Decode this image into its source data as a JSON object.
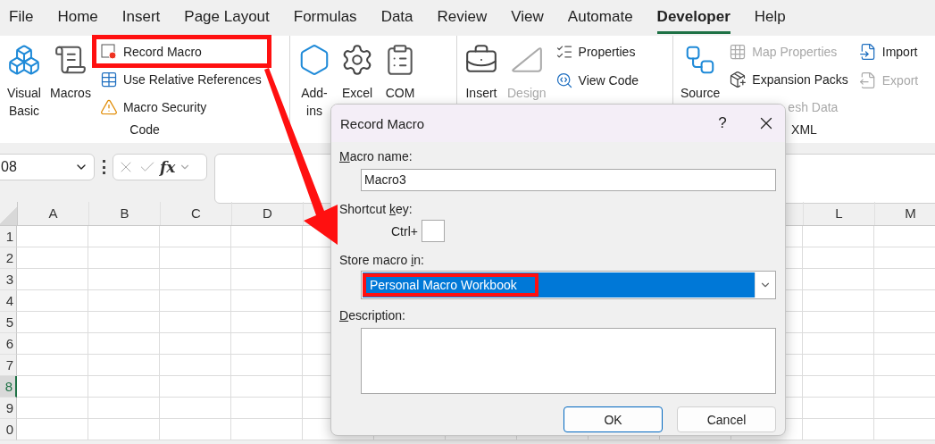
{
  "menu_tabs": [
    {
      "label": "File",
      "selected": false
    },
    {
      "label": "Home",
      "selected": false
    },
    {
      "label": "Insert",
      "selected": false
    },
    {
      "label": "Page Layout",
      "selected": false
    },
    {
      "label": "Formulas",
      "selected": false
    },
    {
      "label": "Data",
      "selected": false
    },
    {
      "label": "Review",
      "selected": false
    },
    {
      "label": "View",
      "selected": false
    },
    {
      "label": "Automate",
      "selected": false
    },
    {
      "label": "Developer",
      "selected": true
    },
    {
      "label": "Help",
      "selected": false
    }
  ],
  "ribbon_groups": [
    {
      "label": "Code",
      "items": [
        {
          "kind": "large",
          "lines": [
            "Visual",
            "Basic"
          ],
          "disabled": false
        },
        {
          "kind": "large",
          "lines": [
            "Macros"
          ],
          "disabled": false
        },
        {
          "kind": "small",
          "lines": [
            "Record Macro"
          ],
          "disabled": false,
          "highlighted": true
        },
        {
          "kind": "small",
          "lines": [
            "Use Relative References"
          ],
          "disabled": false,
          "highlighted": false
        },
        {
          "kind": "small",
          "lines": [
            "Macro Security"
          ],
          "disabled": false,
          "highlighted": false
        }
      ]
    },
    {
      "items": [
        {
          "kind": "large",
          "lines": [
            "Add-",
            "ins"
          ],
          "disabled": false
        },
        {
          "kind": "large",
          "lines": [
            "Excel"
          ],
          "disabled": false
        },
        {
          "kind": "large",
          "lines": [
            "COM"
          ],
          "disabled": false
        }
      ]
    },
    {
      "items": [
        {
          "kind": "large",
          "lines": [
            "Insert"
          ],
          "disabled": false
        },
        {
          "kind": "large",
          "lines": [
            "Design"
          ],
          "disabled": true
        },
        {
          "kind": "small",
          "lines": [
            "Properties"
          ],
          "disabled": false,
          "highlighted": false
        },
        {
          "kind": "small",
          "lines": [
            "View Code"
          ],
          "disabled": false,
          "highlighted": false
        }
      ]
    },
    {
      "label": "XML",
      "items": [
        {
          "kind": "large",
          "lines": [
            "Source"
          ],
          "disabled": false
        },
        {
          "kind": "small",
          "lines": [
            "Map Properties"
          ],
          "disabled": true,
          "highlighted": false
        },
        {
          "kind": "small",
          "lines": [
            "Expansion Packs"
          ],
          "disabled": false,
          "highlighted": false
        },
        {
          "kind": "partial",
          "lines": [
            "esh Data"
          ],
          "disabled": true,
          "highlighted": false
        },
        {
          "kind": "small",
          "lines": [
            "Import"
          ],
          "disabled": false,
          "highlighted": false
        },
        {
          "kind": "small",
          "lines": [
            "Export"
          ],
          "disabled": true,
          "highlighted": false
        }
      ]
    }
  ],
  "formula_bar": {
    "name_box": "08",
    "function_label": "fx"
  },
  "grid": {
    "columns_left": [
      "A",
      "B",
      "C",
      "D"
    ],
    "columns_right": [
      "L",
      "M"
    ],
    "rows": [
      {
        "label": "1",
        "selected": false
      },
      {
        "label": "2",
        "selected": false
      },
      {
        "label": "3",
        "selected": false
      },
      {
        "label": "4",
        "selected": false
      },
      {
        "label": "5",
        "selected": false
      },
      {
        "label": "6",
        "selected": false
      },
      {
        "label": "7",
        "selected": false
      },
      {
        "label": "8",
        "selected": true
      },
      {
        "label": "9",
        "selected": false
      },
      {
        "label": "0",
        "selected": false
      }
    ]
  },
  "dialog": {
    "title": "Record Macro",
    "help": "?",
    "fields": [
      {
        "kind": "text",
        "label_parts": [
          {
            "text": "M",
            "underline": true
          },
          {
            "text": "acro name:",
            "underline": false
          }
        ],
        "value": "Macro3"
      },
      {
        "kind": "shortcut",
        "label_parts": [
          {
            "text": "Shortcut ",
            "underline": false
          },
          {
            "text": "k",
            "underline": true
          },
          {
            "text": "ey:",
            "underline": false
          }
        ],
        "prefix": "Ctrl+"
      },
      {
        "kind": "select",
        "label_parts": [
          {
            "text": "Store macro ",
            "underline": false
          },
          {
            "text": "i",
            "underline": true
          },
          {
            "text": "n:",
            "underline": false
          }
        ],
        "value": "Personal Macro Workbook",
        "highlighted": true
      },
      {
        "kind": "textarea",
        "label_parts": [
          {
            "text": "D",
            "underline": true
          },
          {
            "text": "escription:",
            "underline": false
          }
        ]
      }
    ],
    "buttons": [
      {
        "label": "OK",
        "default": true
      },
      {
        "label": "Cancel",
        "default": false
      }
    ]
  }
}
